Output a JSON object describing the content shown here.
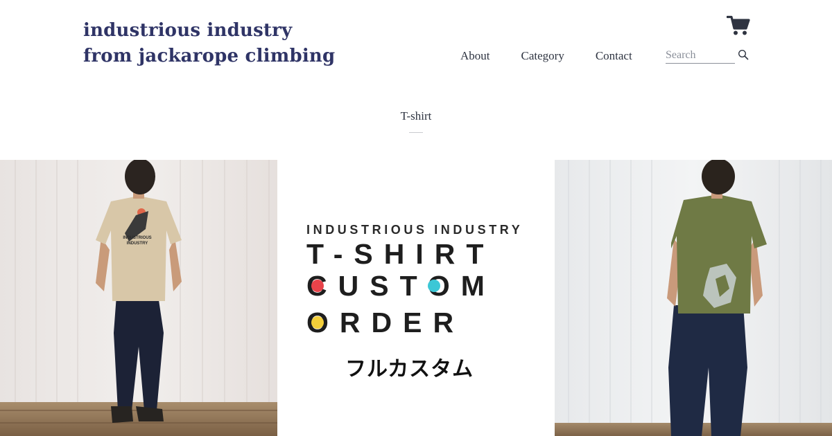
{
  "header": {
    "logo_line1": "industrious industry",
    "logo_line2": "from jackarope climbing",
    "cart_icon": "shopping-cart-icon",
    "nav": {
      "about": "About",
      "category": "Category",
      "contact": "Contact"
    },
    "search": {
      "placeholder": "Search",
      "icon": "search-icon"
    }
  },
  "page": {
    "title": "T-shirt"
  },
  "products": {
    "center": {
      "brand": "INDUSTRIOUS INDUSTRY",
      "line1": "T-SHIRT",
      "line2": "CUSTOM",
      "line3": "ORDER",
      "japanese": "フルカスタム",
      "dot_red": "#e8434a",
      "dot_cyan": "#3cc7d6",
      "dot_yellow": "#f4cf3a"
    },
    "left_shirt_print": "INDUSTRIOUS INDUSTRY",
    "left_shirt_color": "#d8c7a8",
    "right_shirt_color": "#6f7a45"
  },
  "colors": {
    "logo": "#2f3466",
    "text": "#2e3441",
    "cart": "#2f3441"
  }
}
